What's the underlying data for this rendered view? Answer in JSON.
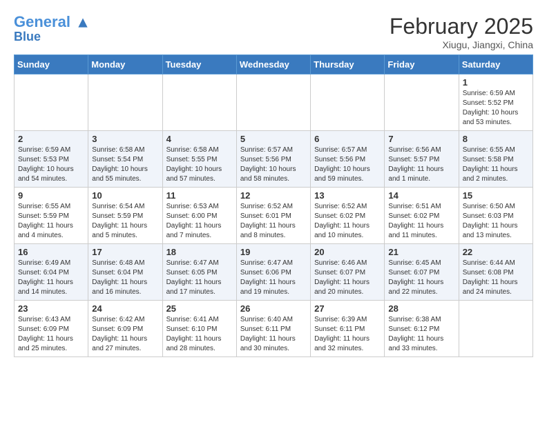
{
  "header": {
    "logo_line1": "General",
    "logo_line2": "Blue",
    "month": "February 2025",
    "location": "Xiugu, Jiangxi, China"
  },
  "weekdays": [
    "Sunday",
    "Monday",
    "Tuesday",
    "Wednesday",
    "Thursday",
    "Friday",
    "Saturday"
  ],
  "weeks": [
    [
      {
        "day": "",
        "info": ""
      },
      {
        "day": "",
        "info": ""
      },
      {
        "day": "",
        "info": ""
      },
      {
        "day": "",
        "info": ""
      },
      {
        "day": "",
        "info": ""
      },
      {
        "day": "",
        "info": ""
      },
      {
        "day": "1",
        "info": "Sunrise: 6:59 AM\nSunset: 5:52 PM\nDaylight: 10 hours\nand 53 minutes."
      }
    ],
    [
      {
        "day": "2",
        "info": "Sunrise: 6:59 AM\nSunset: 5:53 PM\nDaylight: 10 hours\nand 54 minutes."
      },
      {
        "day": "3",
        "info": "Sunrise: 6:58 AM\nSunset: 5:54 PM\nDaylight: 10 hours\nand 55 minutes."
      },
      {
        "day": "4",
        "info": "Sunrise: 6:58 AM\nSunset: 5:55 PM\nDaylight: 10 hours\nand 57 minutes."
      },
      {
        "day": "5",
        "info": "Sunrise: 6:57 AM\nSunset: 5:56 PM\nDaylight: 10 hours\nand 58 minutes."
      },
      {
        "day": "6",
        "info": "Sunrise: 6:57 AM\nSunset: 5:56 PM\nDaylight: 10 hours\nand 59 minutes."
      },
      {
        "day": "7",
        "info": "Sunrise: 6:56 AM\nSunset: 5:57 PM\nDaylight: 11 hours\nand 1 minute."
      },
      {
        "day": "8",
        "info": "Sunrise: 6:55 AM\nSunset: 5:58 PM\nDaylight: 11 hours\nand 2 minutes."
      }
    ],
    [
      {
        "day": "9",
        "info": "Sunrise: 6:55 AM\nSunset: 5:59 PM\nDaylight: 11 hours\nand 4 minutes."
      },
      {
        "day": "10",
        "info": "Sunrise: 6:54 AM\nSunset: 5:59 PM\nDaylight: 11 hours\nand 5 minutes."
      },
      {
        "day": "11",
        "info": "Sunrise: 6:53 AM\nSunset: 6:00 PM\nDaylight: 11 hours\nand 7 minutes."
      },
      {
        "day": "12",
        "info": "Sunrise: 6:52 AM\nSunset: 6:01 PM\nDaylight: 11 hours\nand 8 minutes."
      },
      {
        "day": "13",
        "info": "Sunrise: 6:52 AM\nSunset: 6:02 PM\nDaylight: 11 hours\nand 10 minutes."
      },
      {
        "day": "14",
        "info": "Sunrise: 6:51 AM\nSunset: 6:02 PM\nDaylight: 11 hours\nand 11 minutes."
      },
      {
        "day": "15",
        "info": "Sunrise: 6:50 AM\nSunset: 6:03 PM\nDaylight: 11 hours\nand 13 minutes."
      }
    ],
    [
      {
        "day": "16",
        "info": "Sunrise: 6:49 AM\nSunset: 6:04 PM\nDaylight: 11 hours\nand 14 minutes."
      },
      {
        "day": "17",
        "info": "Sunrise: 6:48 AM\nSunset: 6:04 PM\nDaylight: 11 hours\nand 16 minutes."
      },
      {
        "day": "18",
        "info": "Sunrise: 6:47 AM\nSunset: 6:05 PM\nDaylight: 11 hours\nand 17 minutes."
      },
      {
        "day": "19",
        "info": "Sunrise: 6:47 AM\nSunset: 6:06 PM\nDaylight: 11 hours\nand 19 minutes."
      },
      {
        "day": "20",
        "info": "Sunrise: 6:46 AM\nSunset: 6:07 PM\nDaylight: 11 hours\nand 20 minutes."
      },
      {
        "day": "21",
        "info": "Sunrise: 6:45 AM\nSunset: 6:07 PM\nDaylight: 11 hours\nand 22 minutes."
      },
      {
        "day": "22",
        "info": "Sunrise: 6:44 AM\nSunset: 6:08 PM\nDaylight: 11 hours\nand 24 minutes."
      }
    ],
    [
      {
        "day": "23",
        "info": "Sunrise: 6:43 AM\nSunset: 6:09 PM\nDaylight: 11 hours\nand 25 minutes."
      },
      {
        "day": "24",
        "info": "Sunrise: 6:42 AM\nSunset: 6:09 PM\nDaylight: 11 hours\nand 27 minutes."
      },
      {
        "day": "25",
        "info": "Sunrise: 6:41 AM\nSunset: 6:10 PM\nDaylight: 11 hours\nand 28 minutes."
      },
      {
        "day": "26",
        "info": "Sunrise: 6:40 AM\nSunset: 6:11 PM\nDaylight: 11 hours\nand 30 minutes."
      },
      {
        "day": "27",
        "info": "Sunrise: 6:39 AM\nSunset: 6:11 PM\nDaylight: 11 hours\nand 32 minutes."
      },
      {
        "day": "28",
        "info": "Sunrise: 6:38 AM\nSunset: 6:12 PM\nDaylight: 11 hours\nand 33 minutes."
      },
      {
        "day": "",
        "info": ""
      }
    ]
  ]
}
